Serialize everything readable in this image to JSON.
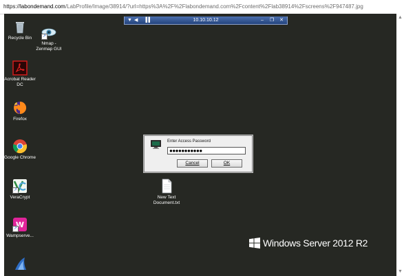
{
  "browser": {
    "url_scheme": "https://",
    "url_domain": "labondemand.com",
    "url_path": "/LabProfile/Image/38914/?url=https%3A%2F%2Flabondemand.com%2Fcontent%2Flab38914%2Fscreens%2F947487.jpg"
  },
  "rdp_bar": {
    "host": "10.10.10.12",
    "pin_icon": "pin-icon",
    "signal_glyph": "▐▐",
    "minimize_glyph": "–",
    "restore_glyph": "❐",
    "close_glyph": "✕"
  },
  "desktop": {
    "icons": [
      {
        "label": "Recycle Bin",
        "icon": "recycle-bin-icon"
      },
      {
        "label": "Nmap - Zenmap GUI",
        "icon": "zenmap-icon"
      },
      {
        "label": "Acrobat Reader DC",
        "icon": "acrobat-icon"
      },
      {
        "label": "Firefox",
        "icon": "firefox-icon"
      },
      {
        "label": "Google Chrome",
        "icon": "chrome-icon"
      },
      {
        "label": "VeraCrypt",
        "icon": "veracrypt-icon"
      },
      {
        "label": "Wampserve...",
        "icon": "wampserver-icon"
      },
      {
        "label": "New Text Document.txt",
        "icon": "text-file-icon"
      }
    ],
    "brand_text": "Windows Server 2012 R2"
  },
  "dialog": {
    "title_label": "Enter Access Password",
    "password_value": "●●●●●●●●●●●",
    "cancel_label": "Cancel",
    "ok_label": "OK"
  },
  "colors": {
    "desktop_bg": "#262823",
    "rdp_bar": "#23447e",
    "dialog_bg": "#efefef"
  }
}
